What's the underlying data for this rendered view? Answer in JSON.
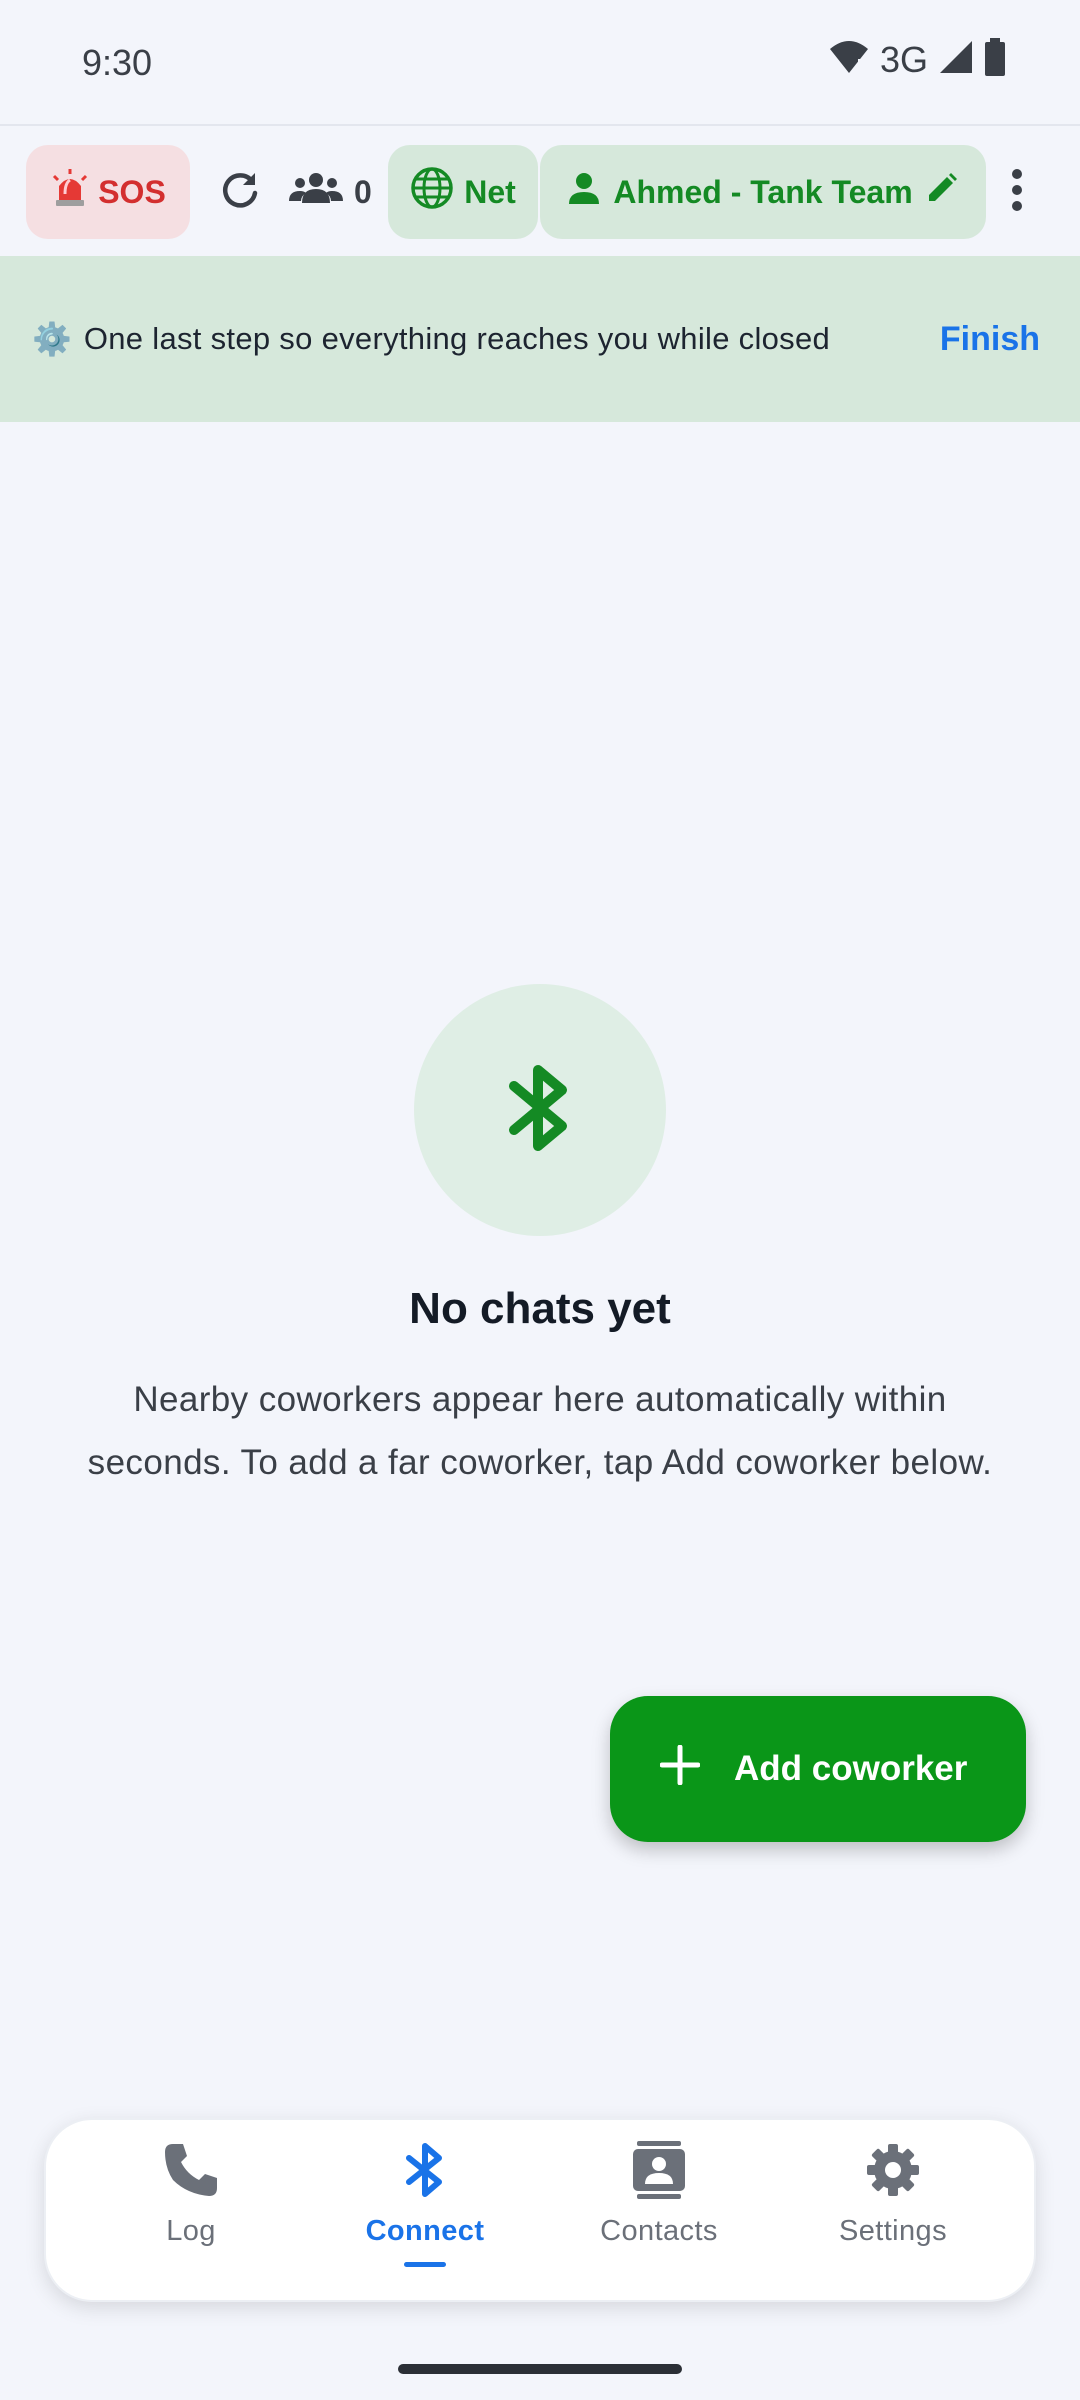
{
  "status_bar": {
    "time": "9:30",
    "network": "3G"
  },
  "toolbar": {
    "sos_label": "SOS",
    "peer_count": "0",
    "net_label": "Net",
    "team_label": "Ahmed - Tank Team"
  },
  "banner": {
    "text": "One last step so everything reaches you while closed",
    "action": "Finish"
  },
  "empty_state": {
    "title": "No chats yet",
    "body": "Nearby coworkers appear here automatically within seconds. To add a far coworker, tap Add coworker below."
  },
  "fab": {
    "label": "Add coworker"
  },
  "bottom_nav": {
    "items": [
      {
        "label": "Log",
        "icon": "phone-icon"
      },
      {
        "label": "Connect",
        "icon": "bluetooth-icon",
        "active": true
      },
      {
        "label": "Contacts",
        "icon": "contact-card-icon"
      },
      {
        "label": "Settings",
        "icon": "gear-icon"
      }
    ]
  },
  "colors": {
    "accent_green": "#0a9618",
    "accent_blue": "#1a73e8",
    "sos_red": "#d32f2f",
    "banner_bg": "#d6e8db"
  }
}
